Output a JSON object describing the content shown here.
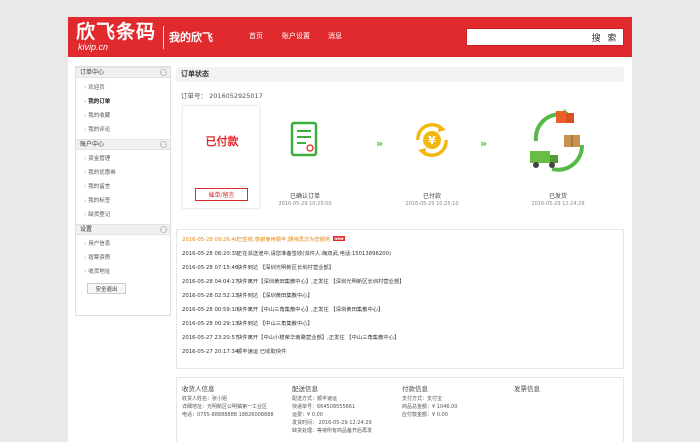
{
  "header": {
    "logo_text": "欣飞条码",
    "logo_sub": "kivip.cn",
    "title": "我的欣飞",
    "nav": [
      "首页",
      "账户设置",
      "消息"
    ],
    "search_placeholder": "",
    "search_button": "搜 索"
  },
  "sidebar": {
    "groups": [
      {
        "title": "订单中心",
        "items": [
          "欢迎页",
          "我的订单",
          "我的收藏",
          "我的评论"
        ]
      },
      {
        "title": "账户中心",
        "items": [
          "资金管理",
          "我的优惠券",
          "我的留言",
          "我的标签",
          "缺货登记"
        ]
      },
      {
        "title": "设置",
        "items": [
          "用户信息",
          "增票资质",
          "收货地址"
        ]
      }
    ],
    "active_item": "我的订单",
    "logout": "安全退出"
  },
  "main": {
    "title": "订单状态",
    "order_no": "订单号： 2016052925017"
  },
  "status": {
    "text": "已付款",
    "button": "催单/留言"
  },
  "steps": [
    {
      "label": "已确认订单",
      "time": "2016-05-29 10:25:00",
      "icon": "document-icon"
    },
    {
      "label": "已付款",
      "time": "2016-05-29 10:25:10",
      "icon": "yen-payment-icon"
    },
    {
      "label": "已发货",
      "time": "2016-05-29 12:24:29",
      "icon": "delivery-truck-icon"
    }
  ],
  "log": [
    {
      "time": "2016-05-28 09:26:40",
      "text": "已签收,感谢使用顺丰,期待再次为您服务",
      "badge": "new"
    },
    {
      "time": "2016-05-28 08:20:39",
      "text": "正在派送途中,请您准备签收(派件人:梅双武,电话:15013896200)"
    },
    {
      "time": "2016-05-28 07:15:46",
      "text": "快件到达 【深圳光明新区长圳村营业部】"
    },
    {
      "time": "2016-05-28 04:04:17",
      "text": "快件离开【深圳黄田集散中心】,正发往 【深圳光明新区长圳村营业部】"
    },
    {
      "time": "2016-05-28 02:52:13",
      "text": "快件到达 【深圳黄田集散中心】"
    },
    {
      "time": "2016-05-28 00:59:10",
      "text": "快件离开【中山三角集散中心】,正发往 【深圳黄田集散中心】"
    },
    {
      "time": "2016-05-28 00:29:13",
      "text": "快件到达 【中山三角集散中心】"
    },
    {
      "time": "2016-05-27 23:20:57",
      "text": "快件离开【中山小榄荣华南路营业部】,正发往 【中山三角集散中心】"
    },
    {
      "time": "2016-05-27 20:17:34",
      "text": "顺丰速运 已收取快件"
    }
  ],
  "info": {
    "receiver": {
      "title": "收货人信息",
      "lines": [
        "收货人姓名：张小姐",
        "详细地址：光明新区公明镇第一工业区",
        "电话：0755-88888888 18826008888"
      ]
    },
    "delivery": {
      "title": "配送信息",
      "lines": [
        "配送方式：顺丰速运",
        "快递单号：664509555661",
        "运费：¥ 0.00",
        "发货时间： 2016-05-29 12:24:29",
        "缺货处理：等待所有商品备齐后再发"
      ]
    },
    "payment": {
      "title": "付款信息",
      "lines": [
        "支付方式：支付宝",
        "商品总金额：¥ 1046.00",
        "应付款金额：¥ 0.00"
      ]
    },
    "invoice": {
      "title": "发票信息",
      "lines": []
    }
  },
  "colors": {
    "brand": "#e02a2e",
    "accent_green": "#57b947",
    "accent_orange": "#e8860d"
  }
}
